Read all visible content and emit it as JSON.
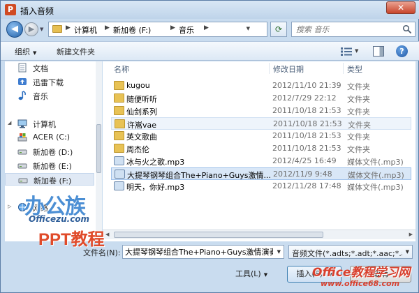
{
  "window": {
    "title": "插入音频",
    "app_icon": "P",
    "close_glyph": "✕",
    "accent": "#3c7fb1"
  },
  "address": {
    "breadcrumb": [
      "计算机",
      "新加卷 (F:)",
      "音乐"
    ],
    "search_placeholder": "搜索 音乐"
  },
  "toolbar": {
    "organize_label": "组织",
    "new_folder_label": "新建文件夹",
    "help_glyph": "?"
  },
  "nav": {
    "items": [
      {
        "label": "文档",
        "icon": "document-icon"
      },
      {
        "label": "迅雷下载",
        "icon": "thunder-download-icon"
      },
      {
        "label": "音乐",
        "icon": "music-note-icon"
      },
      {
        "label": "计算机",
        "icon": "computer-icon"
      },
      {
        "label": "ACER (C:)",
        "icon": "windows-drive-icon"
      },
      {
        "label": "新加卷 (D:)",
        "icon": "drive-icon"
      },
      {
        "label": "新加卷 (E:)",
        "icon": "drive-icon"
      },
      {
        "label": "新加卷 (F:)",
        "icon": "drive-icon"
      },
      {
        "label": "网络",
        "icon": "network-icon"
      }
    ]
  },
  "files": {
    "columns": [
      "名称",
      "修改日期",
      "类型"
    ],
    "rows": [
      {
        "name": "kugou",
        "date": "2012/11/10 21:39",
        "type": "文件夹",
        "icon": "folder-icon"
      },
      {
        "name": "随便听听",
        "date": "2012/7/29 22:12",
        "type": "文件夹",
        "icon": "folder-icon"
      },
      {
        "name": "仙剑系列",
        "date": "2011/10/18 21:53",
        "type": "文件夹",
        "icon": "folder-icon"
      },
      {
        "name": "许嵩vae",
        "date": "2011/10/18 21:53",
        "type": "文件夹",
        "icon": "folder-icon"
      },
      {
        "name": "英文歌曲",
        "date": "2011/10/18 21:53",
        "type": "文件夹",
        "icon": "folder-icon"
      },
      {
        "name": "周杰伦",
        "date": "2011/10/18 21:53",
        "type": "文件夹",
        "icon": "folder-icon"
      },
      {
        "name": "冰与火之歌.mp3",
        "date": "2012/4/25 16:49",
        "type": "媒体文件(.mp3)",
        "icon": "media-file-icon"
      },
      {
        "name": "大提琴钢琴组合The+Piano+Guys激情...",
        "date": "2012/11/9 9:48",
        "type": "媒体文件(.mp3)",
        "icon": "media-file-icon"
      },
      {
        "name": "明天，你好.mp3",
        "date": "2012/11/28 17:48",
        "type": "媒体文件(.mp3)",
        "icon": "media-file-icon"
      }
    ]
  },
  "bottom": {
    "filename_label": "文件名(N):",
    "filename_value": "大提琴钢琴组合The+Piano+Guys激情演奏",
    "filetype_value": "音频文件(*.adts;*.adt;*.aac;*.a",
    "tools_label": "工具(L)",
    "insert_label": "插入(S)",
    "cancel_label": "取消"
  },
  "watermarks": {
    "site1_big": "办公族",
    "site1_domain": "Officezu.com",
    "site1_ppt": "PPT教程",
    "site2_big": "Office教程学习网",
    "site2_domain": "www.office68.com"
  }
}
